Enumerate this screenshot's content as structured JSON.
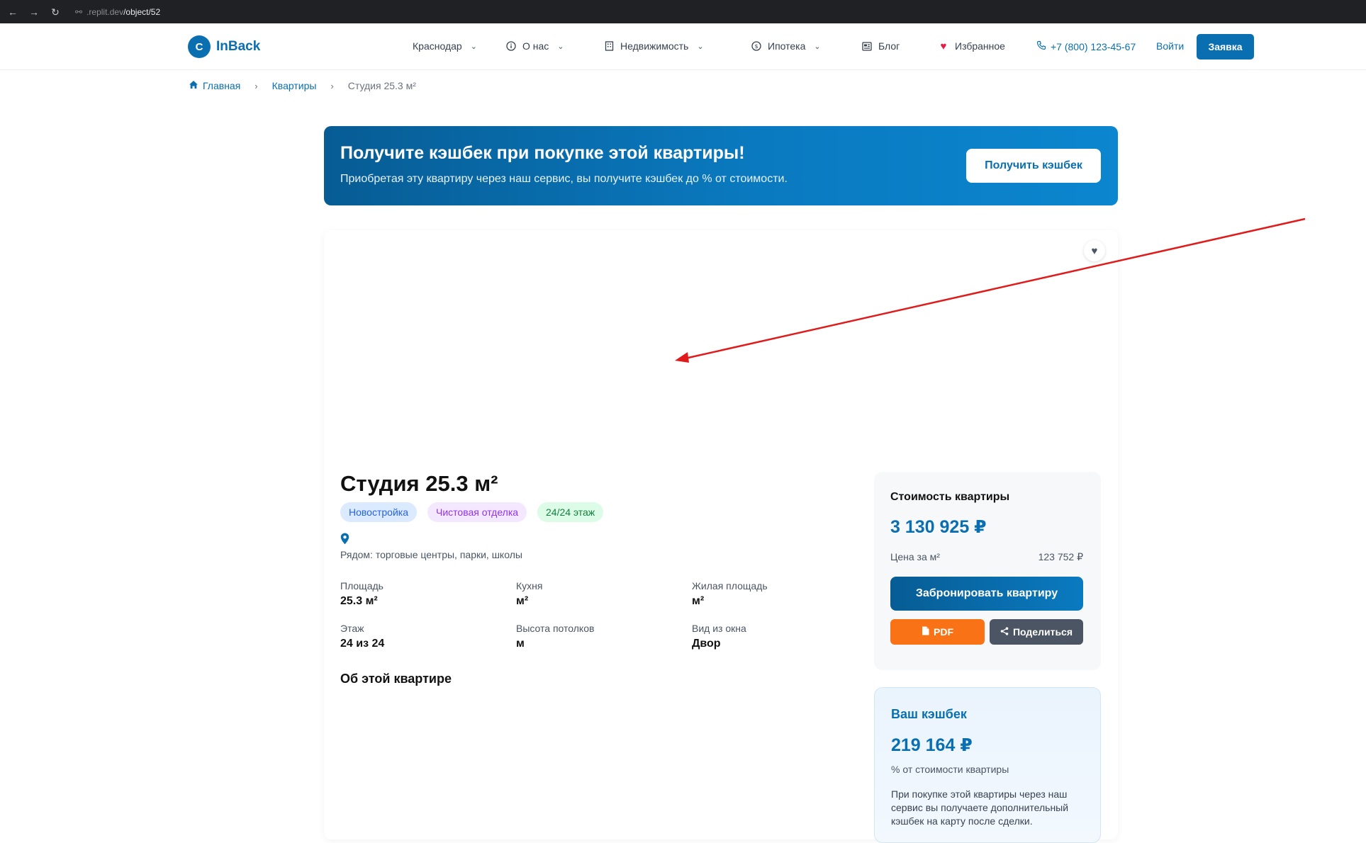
{
  "browser": {
    "url_host": ".replit.dev",
    "url_path": "/object/52"
  },
  "header": {
    "logo_letter": "C",
    "logo_text": "InBack",
    "nav": [
      {
        "label": "Краснодар",
        "icon": "none",
        "dropdown": true
      },
      {
        "label": "О нас",
        "icon": "info-circle-icon",
        "dropdown": true
      },
      {
        "label": "Недвижимость",
        "icon": "building-icon",
        "dropdown": true
      },
      {
        "label": "Ипотека",
        "icon": "dollar-circle-icon",
        "dropdown": true
      },
      {
        "label": "Блог",
        "icon": "newspaper-icon",
        "dropdown": false
      },
      {
        "label": "Избранное",
        "icon": "heart-icon",
        "dropdown": false
      }
    ],
    "phone": "+7 (800) 123-45-67",
    "login": "Войти",
    "apply": "Заявка"
  },
  "breadcrumb": {
    "home": "Главная",
    "section": "Квартиры",
    "current": "Студия 25.3 м²"
  },
  "banner": {
    "title": "Получите кэшбек при покупке этой квартиры!",
    "subtitle": "Приобретая эту квартиру через наш сервис, вы получите кэшбек до % от стоимости.",
    "button": "Получить кэшбек"
  },
  "apartment": {
    "title": "Студия 25.3 м²",
    "tags": [
      "Новостройка",
      "Чистовая отделка",
      "24/24 этаж"
    ],
    "nearby": "Рядом: торговые центры, парки, школы",
    "specs": [
      {
        "label": "Площадь",
        "value": "25.3 м²"
      },
      {
        "label": "Кухня",
        "value": "м²"
      },
      {
        "label": "Жилая площадь",
        "value": "м²"
      },
      {
        "label": "Этаж",
        "value": "24 из 24"
      },
      {
        "label": "Высота потолков",
        "value": "м"
      },
      {
        "label": "Вид из окна",
        "value": "Двор"
      }
    ],
    "about_heading": "Об этой квартире"
  },
  "price": {
    "title": "Стоимость квартиры",
    "total": "3 130 925 ₽",
    "per_m2_label": "Цена за м²",
    "per_m2_value": "123 752 ₽",
    "book": "Забронировать квартиру",
    "pdf": "PDF",
    "share": "Поделиться"
  },
  "cashback": {
    "title": "Ваш кэшбек",
    "amount": "219 164 ₽",
    "note": "% от стоимости квартиры",
    "description": "При покупке этой квартиры через наш сервис вы получаете дополнительный кэшбек на карту после сделки."
  },
  "colors": {
    "brand": "#0a6fb0",
    "orange": "#f97316",
    "annotation": "#e01b1b"
  }
}
